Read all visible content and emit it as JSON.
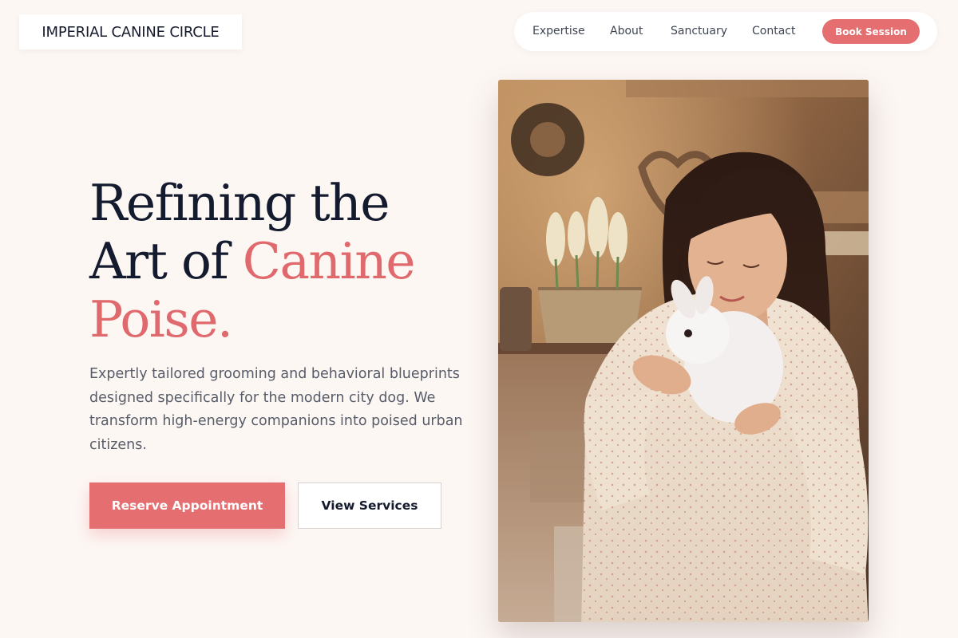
{
  "brand": {
    "name": "IMPERIAL CANINE CIRCLE"
  },
  "nav": {
    "links": [
      "Expertise",
      "About",
      "Sanctuary",
      "Contact"
    ],
    "cta": "Book Session"
  },
  "hero": {
    "headline_line1": "Refining the",
    "headline_line2_plain": "Art of ",
    "headline_line2_accent": "Canine",
    "headline_line3_accent": "Poise.",
    "description": "Expertly tailored grooming and behavioral blueprints designed specifically for the modern city dog. We transform high-energy companions into poised urban citizens.",
    "primary_button": "Reserve Appointment",
    "secondary_button": "View Services"
  },
  "colors": {
    "background": "#fdf7f4",
    "accent": "#e46e70",
    "heading": "#151b2e",
    "body_text": "#575c68"
  }
}
